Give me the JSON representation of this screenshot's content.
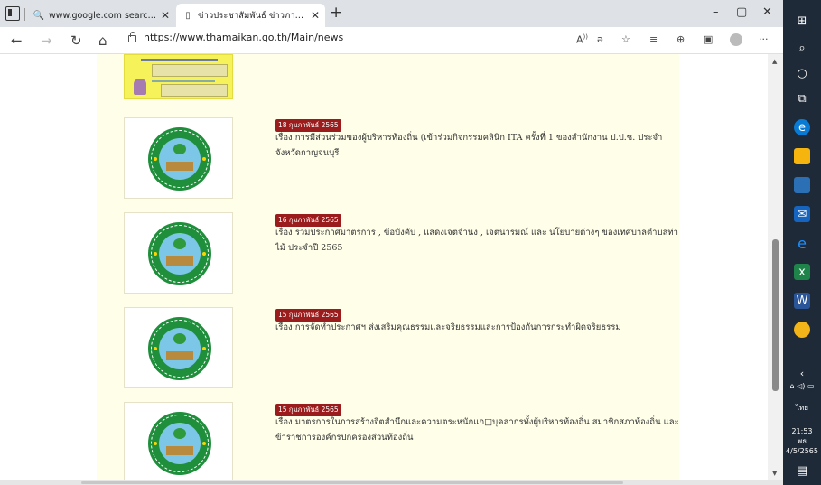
{
  "browser": {
    "tabs": [
      {
        "label": "www.google.com search - Searc",
        "icon": "search-icon"
      },
      {
        "label": "ข่าวประชาสัมพันธ์ ข่าวภาษี ข่าวกิจกรรม",
        "icon": "page-icon"
      }
    ],
    "new_tab_glyph": "+",
    "url": "https://www.thamaikan.go.th/Main/news",
    "window_controls": {
      "minimize": "–",
      "maximize": "▢",
      "close": "✕"
    }
  },
  "news": [
    {
      "date": "18 กุมภาพันธ์ 2565",
      "title": "เรื่อง การมีส่วนร่วมของผู้บริหารท้องถิ่น (เข้าร่วมกิจกรรมคลินิก ITA ครั้งที่ 1 ของสำนักงาน ป.ป.ช. ประจำจังหวัดกาญจนบุรี"
    },
    {
      "date": "16 กุมภาพันธ์ 2565",
      "title": "เรื่อง รวมประกาศมาตรการ , ข้อบังคับ , แสดงเจตจำนง , เจตนารมณ์ และ นโยบายต่างๆ ของเทศบาลตำบลท่าไม้ ประจำปี 2565"
    },
    {
      "date": "15 กุมภาพันธ์ 2565",
      "title": "เรื่อง การจัดทำประกาศฯ ส่งเสริมคุณธรรมและจริยธรรมและการป้องกันการกระทำผิดจริยธรรม"
    },
    {
      "date": "15 กุมภาพันธ์ 2565",
      "title": "เรื่อง มาตรการในการสร้างจิตสำนึกและความตระหนักแก□บุคลากรทั้งผู้บริหารท้องถิ่น สมาชิกสภาท้องถิ่น และข้าราชการองค์กรปกครองส่วนท้องถิ่น"
    }
  ],
  "taskbar": {
    "lang": "ไทย",
    "time": "21:53",
    "day": "พธ",
    "date": "4/5/2565",
    "colors": {
      "bg": "#1f2a38",
      "edge": "#0a7bd5",
      "chrome": "#f1b419"
    }
  }
}
